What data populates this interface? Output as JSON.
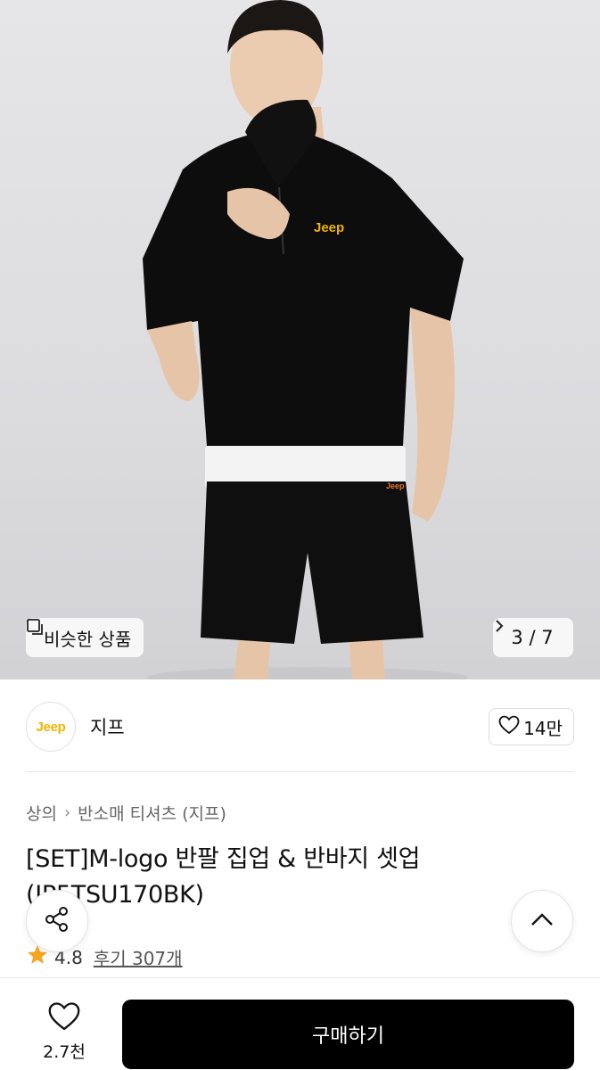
{
  "hero": {
    "similar_label": "비슷한 상품",
    "counter": "3 / 7",
    "shirt_logo_text": "Jeep",
    "shorts_logo_text": "Jeep"
  },
  "brand": {
    "logo_text": "Jeep",
    "name": "지프",
    "like_count": "14만"
  },
  "breadcrumb": [
    "상의",
    "반소매 티셔츠 (지프)"
  ],
  "product": {
    "title": "[SET]M-logo 반팔 집업 & 반바지 셋업 (JP5TSU170BK)"
  },
  "rating": {
    "score": "4.8",
    "reviews": "후기 307개"
  },
  "bottom_bar": {
    "wish_count": "2.7천",
    "buy_label": "구매하기"
  },
  "colors": {
    "accent": "#000000",
    "star": "#f5a623",
    "brand_yellow": "#f0b400"
  },
  "icons": [
    "similar-items-icon",
    "chevron-right-icon",
    "heart-icon",
    "share-icon",
    "chevron-up-icon",
    "star-icon"
  ]
}
